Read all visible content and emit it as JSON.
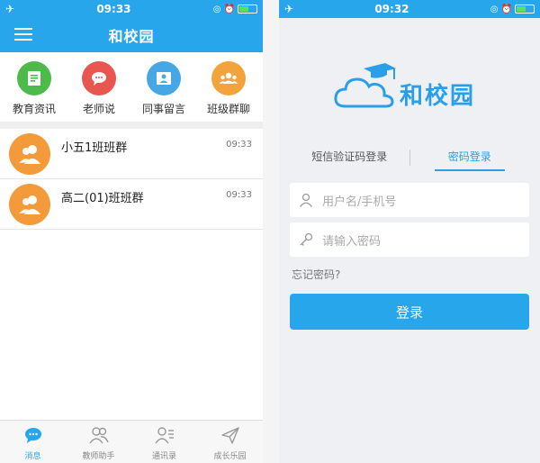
{
  "left_screen": {
    "status": {
      "time": "09:33",
      "airplane": "airplane-icon",
      "battery_level": 0.55
    },
    "nav": {
      "title": "和校园"
    },
    "tiles": [
      {
        "label": "教育资讯",
        "color": "#4cbb4a",
        "icon": "news-icon"
      },
      {
        "label": "老师说",
        "color": "#e9554f",
        "icon": "chat-icon"
      },
      {
        "label": "同事留言",
        "color": "#47a7e5",
        "icon": "contact-card-icon"
      },
      {
        "label": "班级群聊",
        "color": "#f2a33c",
        "icon": "group-icon"
      }
    ],
    "chats": [
      {
        "name": "小五1班班群",
        "time": "09:33"
      },
      {
        "name": "高二(01)班班群",
        "time": "09:33"
      }
    ],
    "tabbar": [
      {
        "label": "消息",
        "icon": "message-icon",
        "active": true
      },
      {
        "label": "教师助手",
        "icon": "teacher-icon",
        "active": false
      },
      {
        "label": "通讯录",
        "icon": "contacts-icon",
        "active": false
      },
      {
        "label": "成长乐园",
        "icon": "send-icon",
        "active": false
      }
    ]
  },
  "right_screen": {
    "status": {
      "time": "09:32",
      "airplane": "airplane-icon",
      "battery_level": 0.55
    },
    "logo": {
      "brand": "和校园",
      "icon": "cloud-graduation-cap-icon"
    },
    "login_tabs": [
      {
        "label": "短信验证码登录",
        "active": false
      },
      {
        "label": "密码登录",
        "active": true
      }
    ],
    "username": {
      "placeholder": "用户名/手机号",
      "icon": "user-icon"
    },
    "password": {
      "placeholder": "请输入密码",
      "icon": "key-icon"
    },
    "forgot": "忘记密码?",
    "login_button": "登录"
  },
  "colors": {
    "primary": "#28a6ec",
    "avatar": "#f39a3a"
  }
}
